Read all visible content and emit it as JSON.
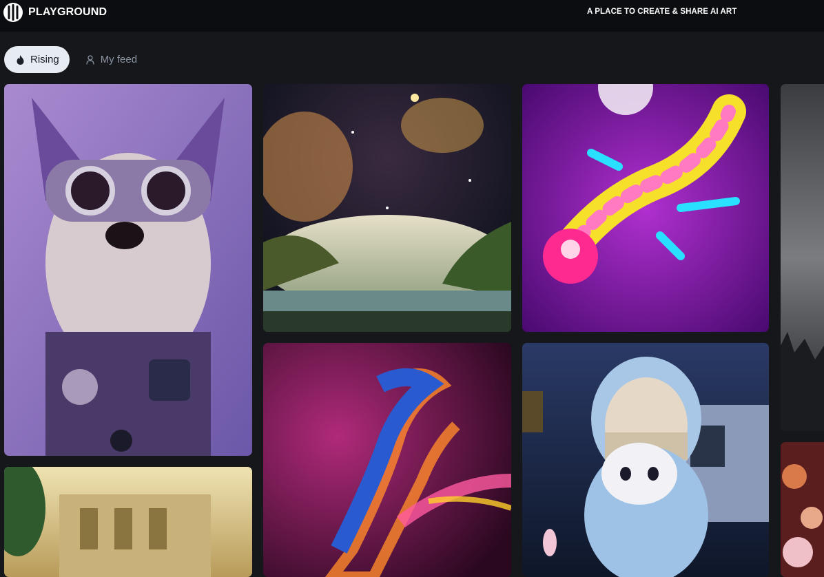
{
  "header": {
    "brand": "PLAYGROUND",
    "tagline": "A PLACE TO CREATE & SHARE AI ART",
    "logo_icon": "playground-logo-icon"
  },
  "tabs": [
    {
      "label": "Rising",
      "icon": "flame-icon",
      "active": true
    },
    {
      "label": "My feed",
      "icon": "user-icon",
      "active": false
    }
  ],
  "gallery": [
    {
      "subject": "cyber-dog",
      "palette": [
        "#9b7cc4",
        "#5a3f86",
        "#c9b2e0"
      ]
    },
    {
      "subject": "fantasy-ruins",
      "palette": [
        "#d9c98e",
        "#3f6b3a",
        "#8a7a4a"
      ]
    },
    {
      "subject": "galaxy-landscape",
      "palette": [
        "#1a1a2e",
        "#d48a3a",
        "#4a6a2a"
      ]
    },
    {
      "subject": "neon-dragon",
      "palette": [
        "#3a0a3a",
        "#ff6a2a",
        "#2a4aa0"
      ]
    },
    {
      "subject": "neon-gecko",
      "palette": [
        "#7a1aa0",
        "#ffe02a",
        "#2ae0ff"
      ]
    },
    {
      "subject": "anime-girl-with-cat",
      "palette": [
        "#1a2a4a",
        "#9ec2e6",
        "#f2e6d6"
      ]
    },
    {
      "subject": "misty-mountains",
      "palette": [
        "#6a6c70",
        "#2a2c30",
        "#9a9ca0"
      ]
    },
    {
      "subject": "flowers",
      "palette": [
        "#8a2a2a",
        "#e09a6a",
        "#4a1a1a"
      ]
    }
  ]
}
